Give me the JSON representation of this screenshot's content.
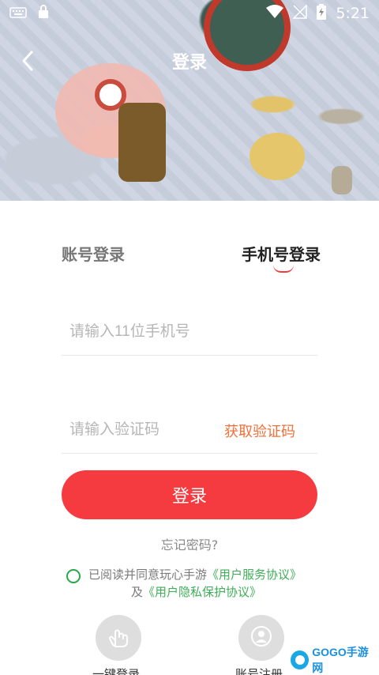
{
  "status_bar": {
    "time": "5:21"
  },
  "header": {
    "title": "登录"
  },
  "tabs": [
    {
      "label": "账号登录"
    },
    {
      "label": "手机号登录"
    }
  ],
  "form": {
    "phone_placeholder": "请输入11位手机号",
    "code_placeholder": "请输入验证码",
    "get_code_label": "获取验证码",
    "login_label": "登录",
    "forgot_label": "忘记密码?"
  },
  "agreement": {
    "prefix": "已阅读并同意玩心手游",
    "service_link": "《用户服务协议》",
    "and": "及",
    "privacy_link": "《用户隐私保护协议》"
  },
  "alt_login": [
    {
      "label": "一键登录",
      "icon": "hand-tap-icon"
    },
    {
      "label": "账号注册",
      "icon": "user-icon"
    }
  ],
  "watermark": {
    "text": "GOGO手游网"
  },
  "colors": {
    "accent": "#f63b40",
    "link": "#3fae58",
    "get_code": "#f0703a"
  }
}
